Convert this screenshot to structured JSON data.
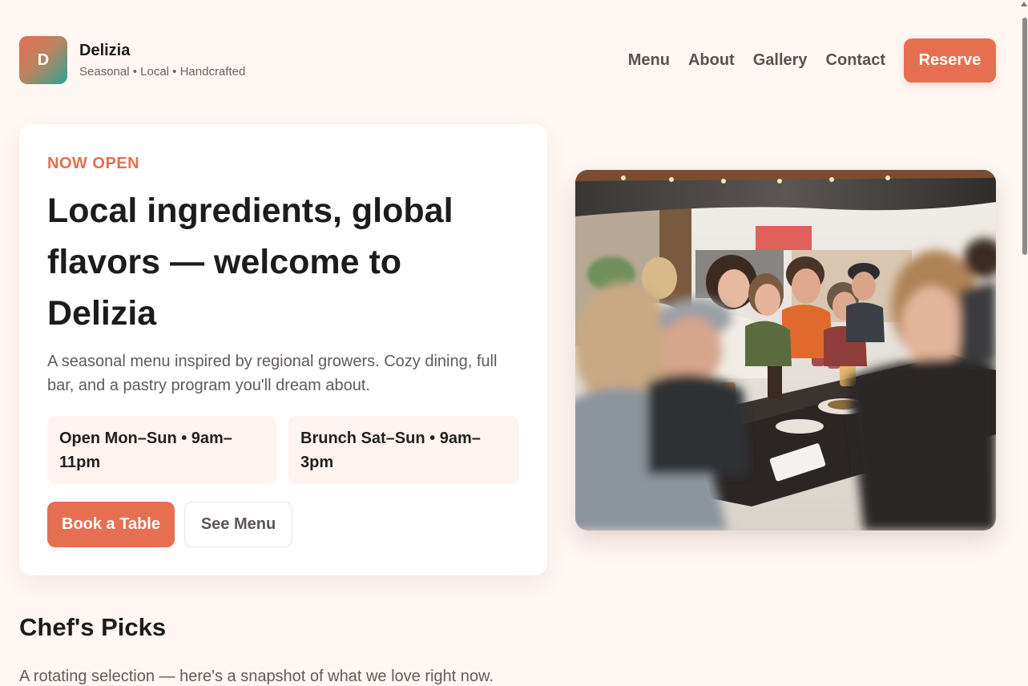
{
  "brand": {
    "logo_letter": "D",
    "name": "Delizia",
    "tagline": "Seasonal • Local • Handcrafted"
  },
  "nav": {
    "links": [
      "Menu",
      "About",
      "Gallery",
      "Contact"
    ],
    "reserve_label": "Reserve"
  },
  "hero": {
    "eyebrow": "NOW OPEN",
    "title": "Local ingredients, global flavors — welcome to Delizia",
    "description": "A seasonal menu inspired by regional growers. Cozy dining, full bar, and a pastry program you'll dream about.",
    "hours": [
      "Open Mon–Sun • 9am–11pm",
      "Brunch Sat–Sun • 9am–3pm"
    ],
    "book_label": "Book a Table",
    "menu_label": "See Menu"
  },
  "picks": {
    "title": "Chef's Picks",
    "subtitle": "A rotating selection — here's a snapshot of what we love right now."
  },
  "colors": {
    "accent": "#e76f51",
    "background": "#fff7f3",
    "chip": "#fff3ef",
    "card": "#ffffff"
  }
}
